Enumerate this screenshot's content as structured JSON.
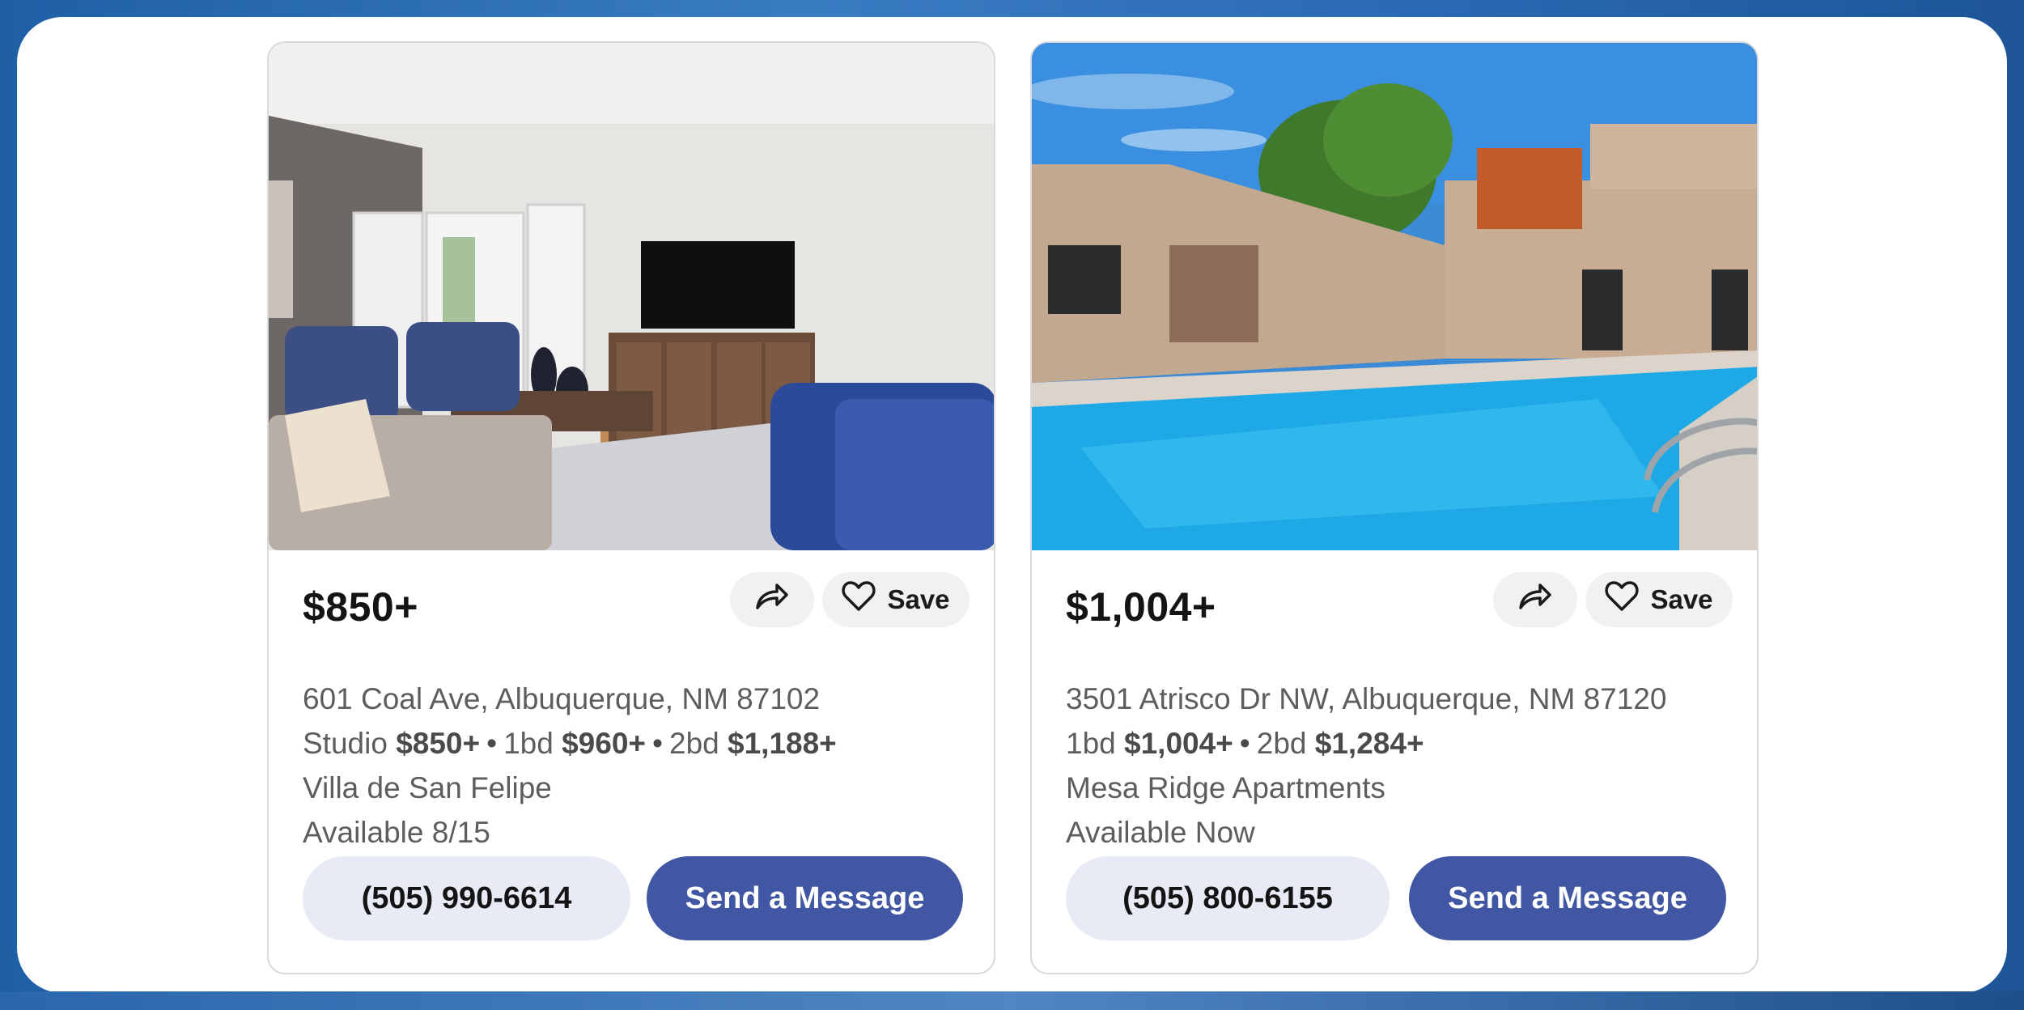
{
  "listings": [
    {
      "price": "$850+",
      "address": "601 Coal Ave, Albuquerque, NM 87102",
      "units": [
        {
          "label": "Studio",
          "price": "$850+"
        },
        {
          "label": "1bd",
          "price": "$960+"
        },
        {
          "label": "2bd",
          "price": "$1,188+"
        }
      ],
      "unit_separator": "•",
      "name": "Villa de San Felipe",
      "availability": "Available 8/15",
      "save_label": "Save",
      "phone": "(505) 990-6614",
      "message_label": "Send a Message",
      "icons": {
        "share": "share-icon",
        "save": "heart-icon"
      }
    },
    {
      "price": "$1,004+",
      "address": "3501 Atrisco Dr NW, Albuquerque, NM 87120",
      "units": [
        {
          "label": "1bd",
          "price": "$1,004+"
        },
        {
          "label": "2bd",
          "price": "$1,284+"
        }
      ],
      "unit_separator": "•",
      "name": "Mesa Ridge Apartments",
      "availability": "Available Now",
      "save_label": "Save",
      "phone": "(505) 800-6155",
      "message_label": "Send a Message",
      "icons": {
        "share": "share-icon",
        "save": "heart-icon"
      }
    }
  ],
  "colors": {
    "primary_button": "#4257a3",
    "secondary_button": "#e8eaf6",
    "background_frame": "#2a6ab4"
  }
}
